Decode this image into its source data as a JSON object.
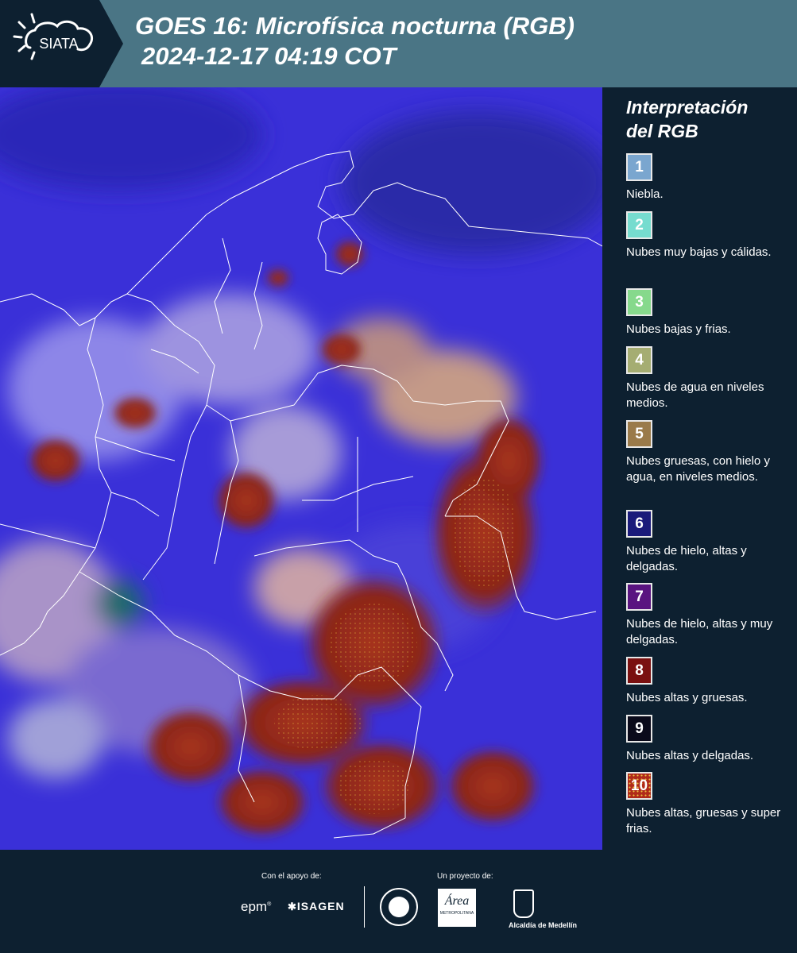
{
  "header": {
    "logo_text": "SIATA",
    "title_line1": "GOES 16: Microfísica nocturna (RGB)",
    "title_line2": "2024-12-17 04:19 COT"
  },
  "legend": {
    "title_line1": "Interpretación",
    "title_line2": "del RGB",
    "items": [
      {
        "num": "1",
        "color": "#7aa6cf",
        "label": "Niebla."
      },
      {
        "num": "2",
        "color": "#76dccf",
        "label": "Nubes muy bajas y cálidas."
      },
      {
        "num": "3",
        "color": "#86d98c",
        "label": "Nubes bajas y frias."
      },
      {
        "num": "4",
        "color": "#a5ad72",
        "label": "Nubes de agua en niveles medios."
      },
      {
        "num": "5",
        "color": "#9a7a4a",
        "label": "Nubes gruesas, con hielo y agua, en niveles medios."
      },
      {
        "num": "6",
        "color": "#1a1a7a",
        "label": "Nubes de hielo, altas y delgadas."
      },
      {
        "num": "7",
        "color": "#5a1480",
        "label": "Nubes de hielo, altas y muy delgadas."
      },
      {
        "num": "8",
        "color": "#7a1010",
        "label": "Nubes altas y gruesas."
      },
      {
        "num": "9",
        "color": "#0a0a1a",
        "label": "Nubes altas y delgadas."
      },
      {
        "num": "10",
        "color": "#b02a1a",
        "label": "Nubes altas, gruesas y super frias."
      }
    ]
  },
  "footer": {
    "support_label": "Con el apoyo de:",
    "project_label": "Un proyecto de:",
    "epm": "epm",
    "isagen": "ISAGEN",
    "area_metro": "Área",
    "area_metro_sub": "METROPOLITANA",
    "alcaldia": "Alcaldía de Medellín"
  }
}
